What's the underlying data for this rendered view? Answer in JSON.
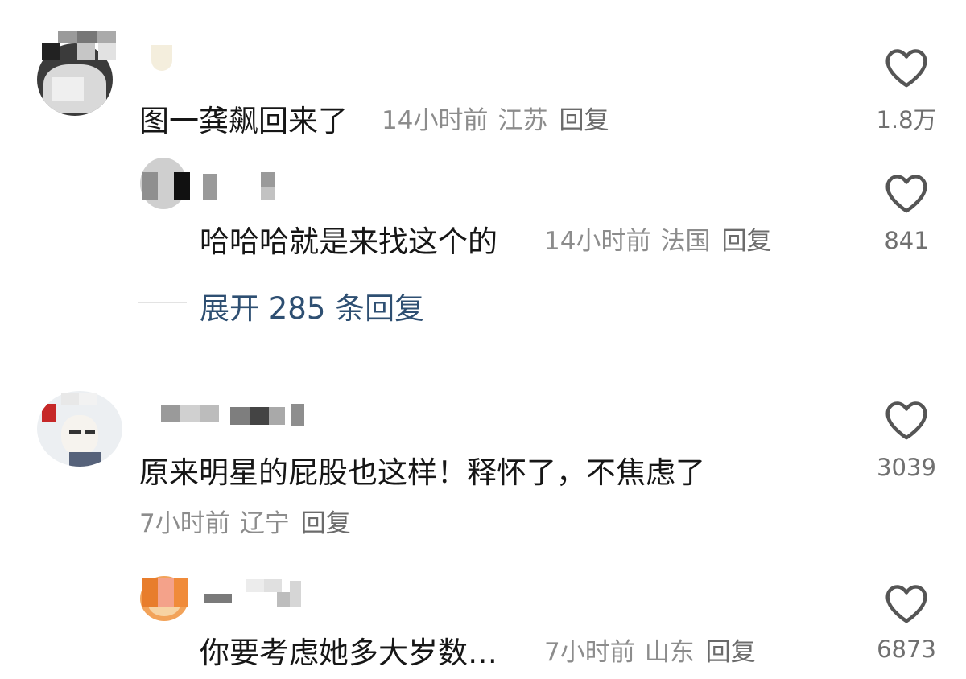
{
  "comments": [
    {
      "text": "图一龚飙回来了",
      "time": "14小时前",
      "location": "江苏",
      "reply_label": "回复",
      "likes": "1.8万"
    },
    {
      "text": "哈哈哈就是来找这个的",
      "time": "14小时前",
      "location": "法国",
      "reply_label": "回复",
      "likes": "841"
    },
    {
      "expand_label": "展开 285 条回复"
    },
    {
      "text": "原来明星的屁股也这样！释怀了，不焦虑了",
      "time": "7小时前",
      "location": "辽宁",
      "reply_label": "回复",
      "likes": "3039"
    },
    {
      "text": "你要考虑她多大岁数…",
      "time": "7小时前",
      "location": "山东",
      "reply_label": "回复",
      "likes": "6873"
    }
  ],
  "icons": {
    "like": "heart-outline-icon"
  },
  "colors": {
    "link": "#2e4f72",
    "meta": "#8c8c8c",
    "text": "#161616"
  }
}
